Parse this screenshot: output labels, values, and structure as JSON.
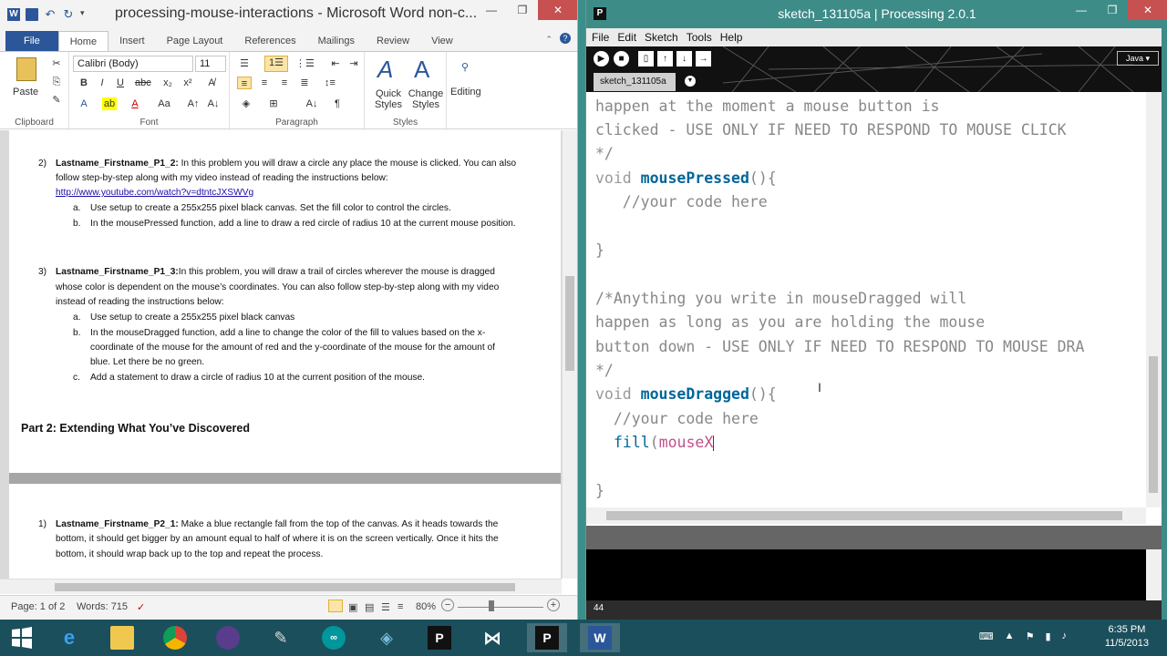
{
  "word": {
    "title": "processing-mouse-interactions - Microsoft Word non-c...",
    "tabs": [
      "File",
      "Home",
      "Insert",
      "Page Layout",
      "References",
      "Mailings",
      "Review",
      "View"
    ],
    "ribbon": {
      "paste_label": "Paste",
      "clipboard_label": "Clipboard",
      "font_name": "Calibri (Body)",
      "font_size": "11",
      "font_label": "Font",
      "paragraph_label": "Paragraph",
      "quick_styles_label": "Quick Styles",
      "change_styles_label": "Change Styles",
      "styles_label": "Styles",
      "editing_label": "Editing"
    },
    "doc": {
      "p1_num": "2)",
      "p1_bold": "Lastname_Firstname_P1_2:",
      "p1_text_a": " In this problem you will draw a circle any place the mouse is clicked. You can also",
      "p1_text_b": "follow step-by-step along with my video instead of reading the instructions below:",
      "p1_link": "http://www.youtube.com/watch?v=dtntcJXSWVg",
      "p1_a_lbl": "a.",
      "p1_a": "Use setup to create a 255x255 pixel black canvas. Set the fill color to control the circles.",
      "p1_b_lbl": "b.",
      "p1_b": "In the mousePressed function, add a line to draw a red circle of radius 10 at the current mouse position.",
      "p2_num": "3)",
      "p2_bold": "Lastname_Firstname_P1_3:",
      "p2_text_a": "In this problem, you will draw a trail of circles wherever the mouse is dragged",
      "p2_text_b": "whose color is dependent on the mouse’s coordinates. You can also follow step-by-step along with my video",
      "p2_text_c": "instead of reading the instructions below:",
      "p2_a_lbl": "a.",
      "p2_a": "Use setup to create a 255x255  pixel black canvas",
      "p2_b_lbl": "b.",
      "p2_b1": "In the mouseDragged function, add a line to change the color of the fill to values based on the x-",
      "p2_b2": "coordinate of the mouse for the amount of red and the y-coordinate of the mouse for the amount of",
      "p2_b3": "blue. Let there be no green.",
      "p2_c_lbl": "c.",
      "p2_c": "Add a statement to draw a circle  of radius 10 at the current position of the mouse.",
      "heading": "Part 2: Extending What You’ve Discovered",
      "p3_num": "1)",
      "p3_bold": "Lastname_Firstname_P2_1:",
      "p3_text_a": " Make a blue rectangle fall from the top of the canvas. As it heads towards the",
      "p3_text_b": "bottom, it should get bigger by an amount equal to half of where it is on the screen vertically. Once it hits the",
      "p3_text_c": "bottom, it should wrap back up to the top and repeat the process."
    },
    "status": {
      "page": "Page: 1 of 2",
      "words": "Words: 715",
      "zoom": "80%"
    }
  },
  "processing": {
    "title": "sketch_131105a | Processing 2.0.1",
    "menu": [
      "File",
      "Edit",
      "Sketch",
      "Tools",
      "Help"
    ],
    "mode": "Java ▾",
    "sketch_tab": "sketch_131105a",
    "code": {
      "l1": "happen at the moment a mouse button is",
      "l2": "clicked - USE ONLY IF NEED TO RESPOND TO MOUSE CLICK",
      "l3": "*/",
      "l4_void": "void ",
      "l4_fn": "mousePressed",
      "l4_rest": "(){",
      "l5": "   //your code here",
      "l7": "}",
      "l9": "/*Anything you write in mouseDragged will",
      "l10": "happen as long as you are holding the mouse",
      "l11": "button down - USE ONLY IF NEED TO RESPOND TO MOUSE DRA",
      "l12": "*/",
      "l13_void": "void ",
      "l13_fn": "mouseDragged",
      "l13_rest": "(){",
      "l14": "  //your code here",
      "l15_fn": "fill",
      "l15_paren": "(",
      "l15_arg": "mouseX",
      "l17": "}"
    },
    "line_number": "44"
  },
  "taskbar": {
    "time": "6:35 PM",
    "date": "11/5/2013"
  },
  "colors": {
    "word_blue": "#2b579a",
    "processing_teal": "#3d8c88",
    "taskbar": "#1b4f5c"
  }
}
